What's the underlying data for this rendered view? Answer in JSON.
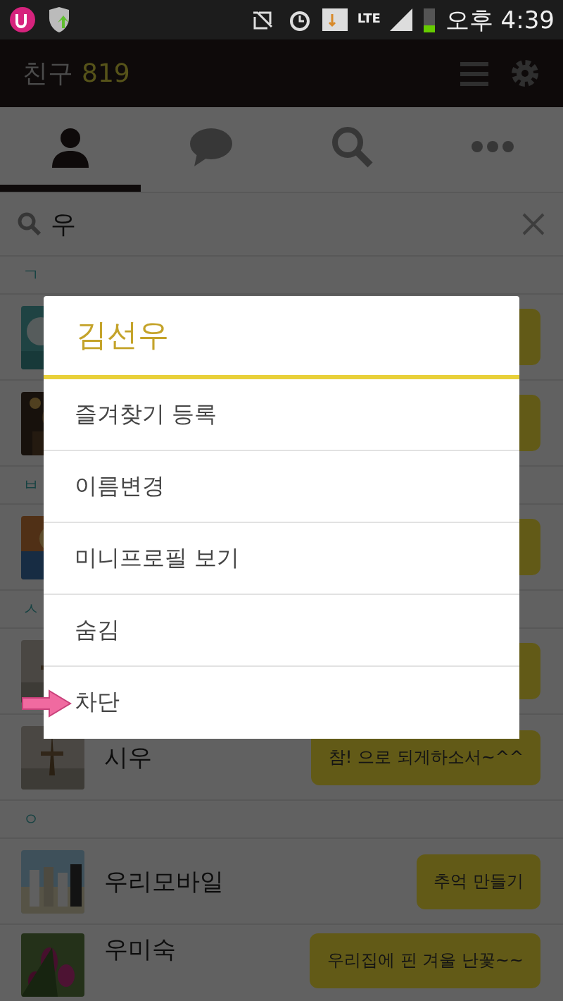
{
  "status_bar": {
    "network": "LTE",
    "time": "오후 4:39"
  },
  "header": {
    "title": "친구",
    "count": "819"
  },
  "tabs": [
    {
      "kind": "person",
      "selected": true
    },
    {
      "kind": "chat",
      "selected": false
    },
    {
      "kind": "search",
      "selected": false
    },
    {
      "kind": "more",
      "selected": false
    }
  ],
  "search": {
    "value": "우"
  },
  "list": [
    {
      "kind": "section",
      "label": "ㄱ"
    },
    {
      "kind": "friend"
    },
    {
      "kind": "friend"
    },
    {
      "kind": "section",
      "label": "ㅂ"
    },
    {
      "kind": "friend"
    },
    {
      "kind": "section",
      "label": "ㅅ"
    },
    {
      "kind": "friend"
    },
    {
      "kind": "friend",
      "name": "시우",
      "status": "참! 으로 되게하소서~^^"
    },
    {
      "kind": "section",
      "label": "ㅇ"
    },
    {
      "kind": "friend",
      "name": "우리모바일",
      "status": "추억 만들기"
    },
    {
      "kind": "friend",
      "name": "우미숙",
      "status": "우리집에 핀 겨울 난꽃~~"
    }
  ],
  "dialog": {
    "title": "김선우",
    "items": [
      {
        "label": "즐겨찾기 등록",
        "pointed": false
      },
      {
        "label": "이름변경",
        "pointed": false
      },
      {
        "label": "미니프로필 보기",
        "pointed": false
      },
      {
        "label": "숨김",
        "pointed": false
      },
      {
        "label": "차단",
        "pointed": true
      }
    ]
  }
}
